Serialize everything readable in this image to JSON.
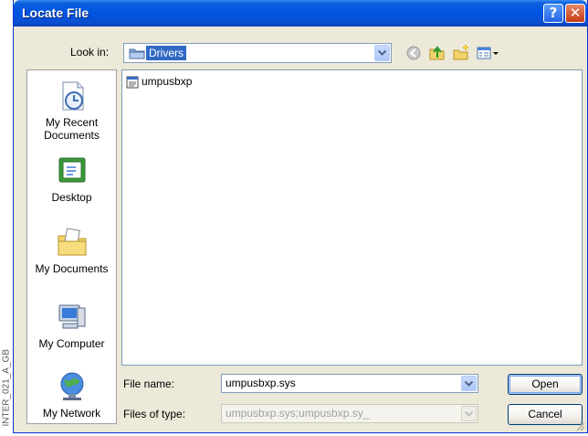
{
  "window": {
    "title": "Locate File",
    "help_glyph": "?",
    "close_glyph": "✕"
  },
  "side_caption": "INTER_021_A_GB",
  "look_in": {
    "label": "Look in:",
    "value": "Drivers"
  },
  "toolbar": {
    "icons": [
      "back-icon",
      "up-folder-icon",
      "new-folder-icon",
      "view-menu-icon"
    ]
  },
  "places": [
    {
      "label": "My Recent Documents",
      "icon": "recent-documents-icon"
    },
    {
      "label": "Desktop",
      "icon": "desktop-icon"
    },
    {
      "label": "My Documents",
      "icon": "my-documents-icon"
    },
    {
      "label": "My Computer",
      "icon": "my-computer-icon"
    },
    {
      "label": "My Network",
      "icon": "my-network-icon"
    }
  ],
  "files": [
    {
      "name": "umpusbxp",
      "icon": "system-file-icon"
    }
  ],
  "file_name": {
    "label": "File name:",
    "value": "umpusbxp.sys"
  },
  "files_of_type": {
    "label": "Files of type:",
    "value": "umpusbxp.sys;umpusbxp.sy_"
  },
  "buttons": {
    "open": "Open",
    "cancel": "Cancel"
  },
  "colors": {
    "titlebar": "#0054e3",
    "dialog_bg": "#ece9d8",
    "selection": "#316ac5",
    "close_button": "#c63b12"
  }
}
